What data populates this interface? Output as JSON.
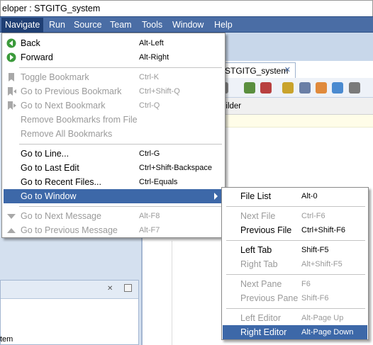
{
  "window": {
    "title": "eloper : STGITG_system"
  },
  "menubar": {
    "items": [
      "Navigate",
      "Run",
      "Source",
      "Team",
      "Tools",
      "Window",
      "Help"
    ]
  },
  "editor": {
    "tab_label": "STGITG_system",
    "tab_close": "✕",
    "subheader": "uilder"
  },
  "left_pane": {
    "bottom_text": "tem"
  },
  "navigate_menu": {
    "items": [
      {
        "label": "Back",
        "accel": "Alt-Left",
        "icon": "back-arrow-icon",
        "enabled": true
      },
      {
        "label": "Forward",
        "accel": "Alt-Right",
        "icon": "forward-arrow-icon",
        "enabled": true
      },
      {
        "label": "Toggle Bookmark",
        "accel": "Ctrl-K",
        "icon": "bookmark-icon",
        "enabled": false
      },
      {
        "label": "Go to Previous Bookmark",
        "accel": "Ctrl+Shift-Q",
        "icon": "previous-bookmark-icon",
        "enabled": false
      },
      {
        "label": "Go to Next Bookmark",
        "accel": "Ctrl-Q",
        "icon": "next-bookmark-icon",
        "enabled": false
      },
      {
        "label": "Remove Bookmarks from File",
        "accel": "",
        "enabled": false
      },
      {
        "label": "Remove All Bookmarks",
        "accel": "",
        "enabled": false
      },
      {
        "label": "Go to Line...",
        "accel": "Ctrl-G",
        "enabled": true
      },
      {
        "label": "Go to Last Edit",
        "accel": "Ctrl+Shift-Backspace",
        "enabled": true
      },
      {
        "label": "Go to Recent Files...",
        "accel": "Ctrl-Equals",
        "enabled": true
      },
      {
        "label": "Go to Window",
        "accel": "",
        "enabled": true,
        "highlighted": true,
        "submenu": true
      },
      {
        "label": "Go to Next Message",
        "accel": "Alt-F8",
        "icon": "next-message-icon",
        "enabled": false
      },
      {
        "label": "Go to Previous Message",
        "accel": "Alt-F7",
        "icon": "previous-message-icon",
        "enabled": false
      }
    ]
  },
  "window_submenu": {
    "items": [
      {
        "label": "File List",
        "accel": "Alt-0",
        "enabled": true
      },
      {
        "label": "Next File",
        "accel": "Ctrl-F6",
        "enabled": false
      },
      {
        "label": "Previous File",
        "accel": "Ctrl+Shift-F6",
        "enabled": true
      },
      {
        "label": "Left Tab",
        "accel": "Shift-F5",
        "enabled": true
      },
      {
        "label": "Right Tab",
        "accel": "Alt+Shift-F5",
        "enabled": false
      },
      {
        "label": "Next Pane",
        "accel": "F6",
        "enabled": false
      },
      {
        "label": "Previous Pane",
        "accel": "Shift-F6",
        "enabled": false
      },
      {
        "label": "Left Editor",
        "accel": "Alt-Page Up",
        "enabled": false
      },
      {
        "label": "Right Editor",
        "accel": "Alt-Page Down",
        "enabled": true,
        "highlighted": true
      }
    ]
  },
  "colors": {
    "menubar": "#4a6da5",
    "highlight": "#3d68a8",
    "disabled": "#9a9a9a"
  }
}
